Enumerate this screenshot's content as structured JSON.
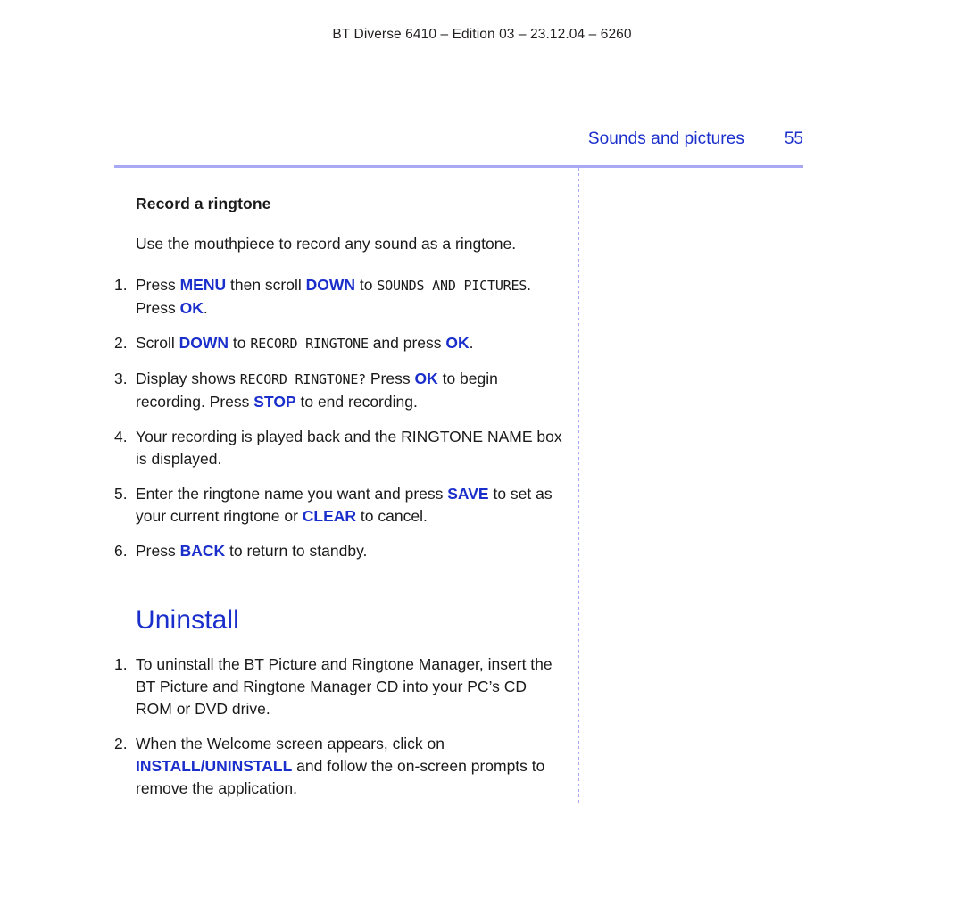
{
  "header": {
    "running_head": "BT Diverse 6410 – Edition 03 – 23.12.04 – 6260"
  },
  "page_title": {
    "section": "Sounds and pictures",
    "number": "55"
  },
  "colors": {
    "accent_blue": "#1a2ecc",
    "rule_blue": "#a8a8f5",
    "body_text": "#1a1a1a"
  },
  "sections": [
    {
      "id": "record-a-ringtone",
      "heading": "Record a ringtone",
      "heading_level": "sub",
      "intro": "Use the mouthpiece to record any sound as a ringtone.",
      "steps": [
        {
          "num": "1.",
          "runs": [
            {
              "style": "plain",
              "text": "Press "
            },
            {
              "style": "key",
              "text": "MENU"
            },
            {
              "style": "plain",
              "text": " then scroll "
            },
            {
              "style": "key",
              "text": "DOWN"
            },
            {
              "style": "plain",
              "text": " to "
            },
            {
              "style": "display",
              "text": "SOUNDS AND PICTURES"
            },
            {
              "style": "plain",
              "text": ". Press "
            },
            {
              "style": "key",
              "text": "OK"
            },
            {
              "style": "plain",
              "text": "."
            }
          ]
        },
        {
          "num": "2.",
          "runs": [
            {
              "style": "plain",
              "text": "Scroll "
            },
            {
              "style": "key",
              "text": "DOWN"
            },
            {
              "style": "plain",
              "text": " to "
            },
            {
              "style": "display",
              "text": "RECORD RINGTONE"
            },
            {
              "style": "plain",
              "text": " and press "
            },
            {
              "style": "key",
              "text": "OK"
            },
            {
              "style": "plain",
              "text": "."
            }
          ]
        },
        {
          "num": "3.",
          "runs": [
            {
              "style": "plain",
              "text": "Display shows "
            },
            {
              "style": "display",
              "text": "RECORD RINGTONE?"
            },
            {
              "style": "plain",
              "text": " Press "
            },
            {
              "style": "key",
              "text": "OK"
            },
            {
              "style": "plain",
              "text": " to begin recording. Press "
            },
            {
              "style": "key",
              "text": "STOP"
            },
            {
              "style": "plain",
              "text": " to end recording."
            }
          ]
        },
        {
          "num": "4.",
          "runs": [
            {
              "style": "plain",
              "text": "Your recording is played back and the "
            },
            {
              "style": "caps",
              "text": "RINGTONE NAME"
            },
            {
              "style": "plain",
              "text": " box is displayed."
            }
          ]
        },
        {
          "num": "5.",
          "runs": [
            {
              "style": "plain",
              "text": "Enter the ringtone name you want and press "
            },
            {
              "style": "key",
              "text": "SAVE"
            },
            {
              "style": "plain",
              "text": " to set as your current ringtone or "
            },
            {
              "style": "key",
              "text": "CLEAR"
            },
            {
              "style": "plain",
              "text": " to cancel."
            }
          ]
        },
        {
          "num": "6.",
          "runs": [
            {
              "style": "plain",
              "text": "Press "
            },
            {
              "style": "key",
              "text": "BACK"
            },
            {
              "style": "plain",
              "text": " to return to standby."
            }
          ]
        }
      ]
    },
    {
      "id": "uninstall",
      "heading": "Uninstall",
      "heading_level": "main",
      "intro": "",
      "steps": [
        {
          "num": "1.",
          "runs": [
            {
              "style": "plain",
              "text": "To uninstall the BT Picture and Ringtone Manager, insert the BT Picture and Ringtone Manager CD into your PC’s CD ROM or DVD drive."
            }
          ]
        },
        {
          "num": "2.",
          "runs": [
            {
              "style": "plain",
              "text": "When the Welcome screen appears, click on "
            },
            {
              "style": "key",
              "text": "INSTALL/UNINSTALL"
            },
            {
              "style": "plain",
              "text": " and follow the on-screen prompts to remove the application."
            }
          ]
        }
      ]
    }
  ]
}
